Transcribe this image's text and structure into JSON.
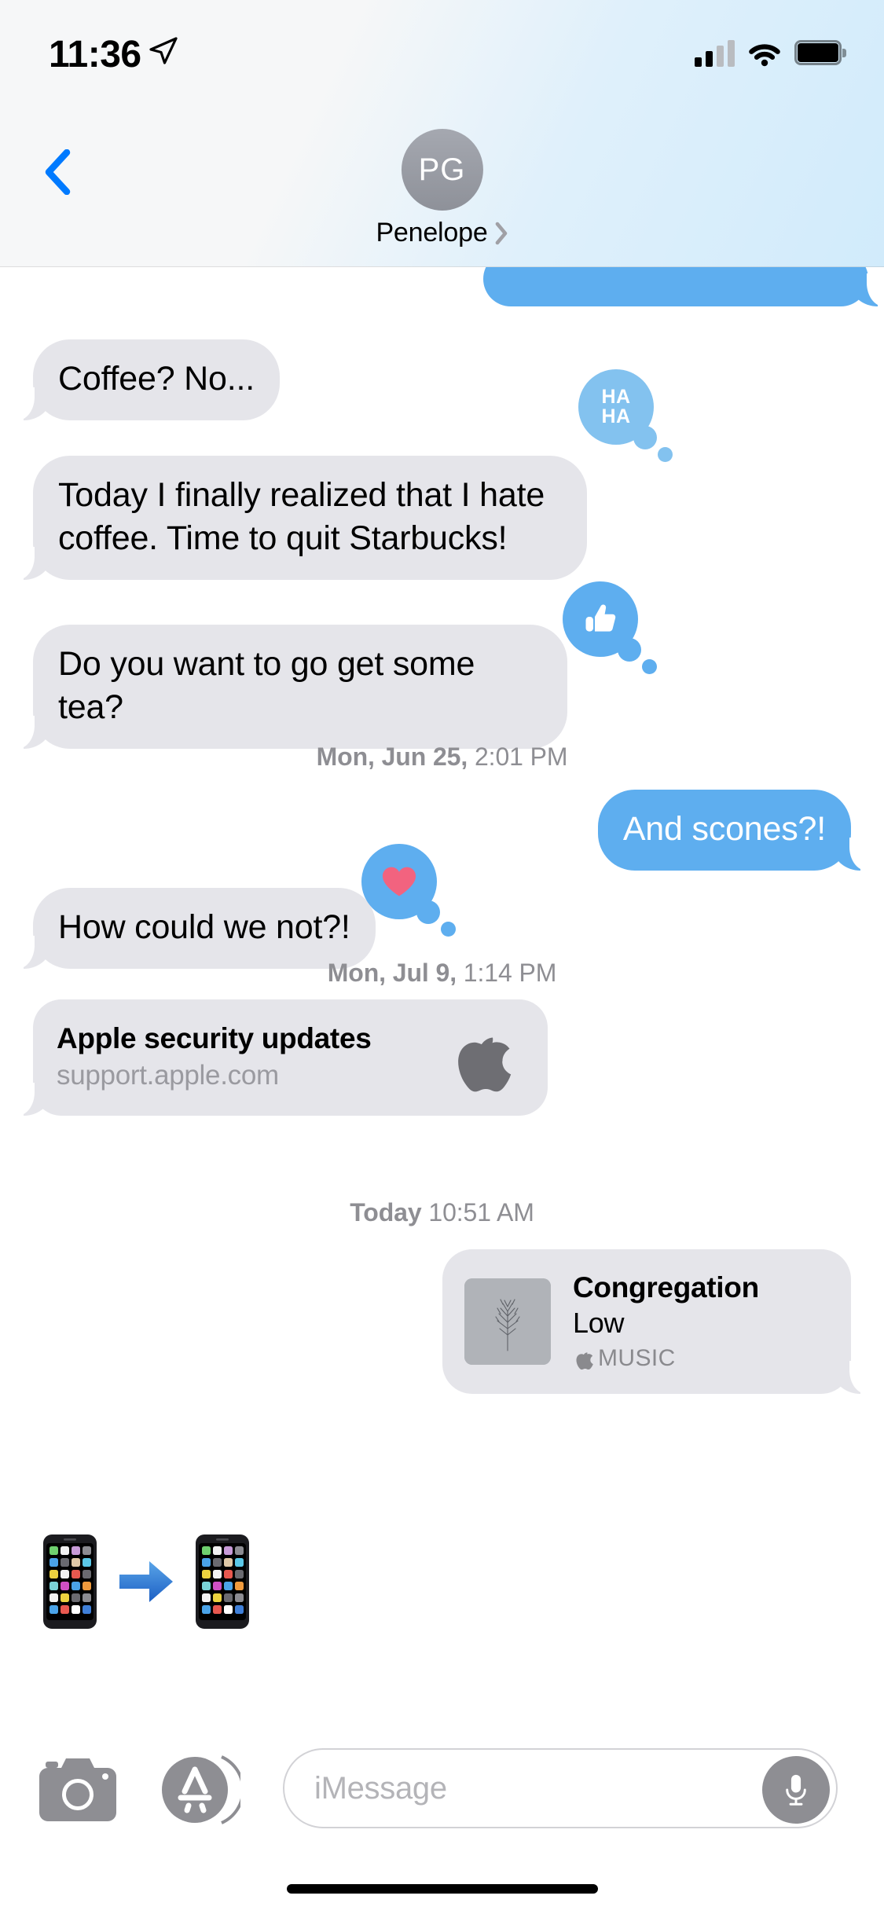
{
  "status_bar": {
    "time": "11:36",
    "location_icon": "location-arrow-icon",
    "cellular_icon": "cellular-signal-icon",
    "wifi_icon": "wifi-icon",
    "battery_icon": "battery-full-icon"
  },
  "nav_bar": {
    "back_label": "back-chevron",
    "avatar_initials": "PG",
    "contact_name": "Penelope",
    "detail_chevron": "chevron-right-icon"
  },
  "conversation": {
    "messages": [
      {
        "id": "m0",
        "sender": "me",
        "text": "",
        "note": "partially visible blue bubble clipped by nav bar"
      },
      {
        "id": "m1",
        "sender": "them",
        "text": "Coffee? No..."
      },
      {
        "id": "m2",
        "sender": "them",
        "text": "Today I finally realized that I hate coffee. Time to quit Starbucks!",
        "tapback": "haha"
      },
      {
        "id": "m3",
        "sender": "them",
        "text": "Do you want to go get some tea?",
        "tapback": "thumbs-up"
      },
      {
        "id": "m4",
        "sender": "me",
        "text": "And scones?!"
      },
      {
        "id": "m5",
        "sender": "them",
        "text": "How could we not?!",
        "tapback": "heart"
      }
    ],
    "tapbacks": {
      "haha": "HA\nHA",
      "haha_line1": "HA",
      "haha_line2": "HA",
      "thumbs_up": "thumbs-up-icon",
      "heart": "heart-icon"
    },
    "timestamps": [
      {
        "id": "t1",
        "date": "Mon, Jun 25,",
        "time": " 2:01 PM"
      },
      {
        "id": "t2",
        "date": "Mon, Jul 9,",
        "time": " 1:14 PM"
      },
      {
        "id": "t3",
        "date": "Today",
        "time": " 10:51 AM"
      }
    ],
    "link_preview": {
      "title": "Apple security updates",
      "url": "support.apple.com",
      "icon": "apple-logo-icon"
    },
    "music_card": {
      "title": "Congregation",
      "artist": "Low",
      "service": "MUSIC",
      "service_icon": "apple-logo-icon",
      "artwork": "bare-tree-album-art"
    },
    "sticker": {
      "left_icon": "mobile-phone-emoji",
      "arrow_icon": "right-arrow-emoji",
      "right_icon": "mobile-phone-emoji"
    }
  },
  "input_bar": {
    "camera_icon": "camera-icon",
    "appstore_icon": "app-store-icon",
    "placeholder": "iMessage",
    "mic_icon": "microphone-icon"
  },
  "colors": {
    "outgoing_bubble": "#5eaeef",
    "incoming_bubble": "#e5e5ea",
    "accent_blue": "#007aff",
    "tapback_blue": "#5eaeef",
    "heart_pink": "#f2637f",
    "timestamp_gray": "#8e8e93"
  }
}
